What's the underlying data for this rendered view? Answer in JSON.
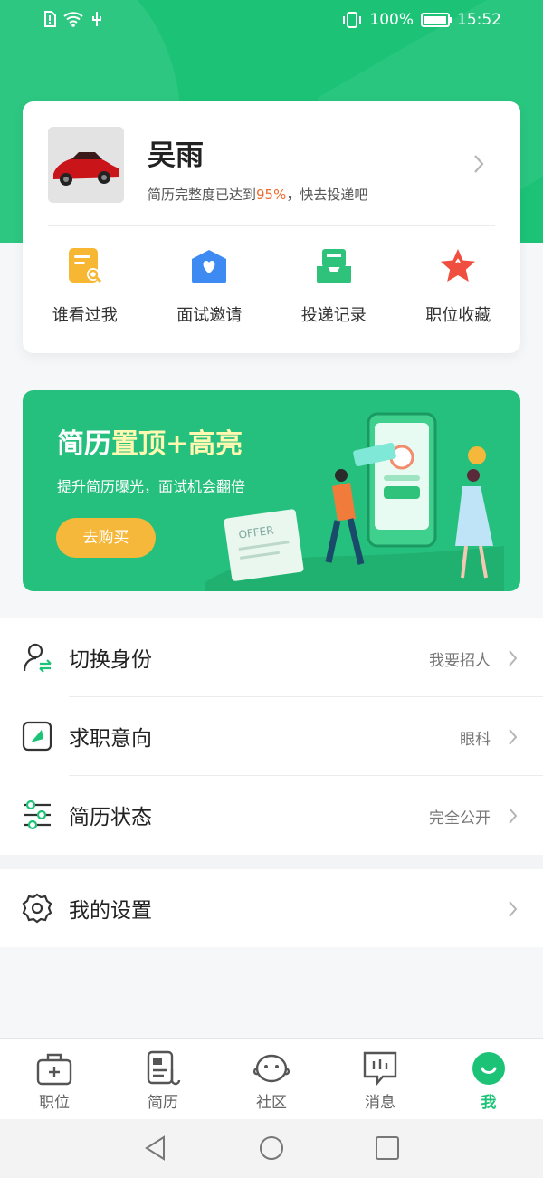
{
  "status_bar": {
    "battery": "100%",
    "time": "15:52"
  },
  "profile": {
    "name": "吴雨",
    "completeness_prefix": "简历完整度已达到",
    "completeness_pct": "95%",
    "completeness_suffix": "，快去投递吧"
  },
  "quick_actions": [
    {
      "label": "谁看过我",
      "icon": "viewed-me-icon",
      "color": "#f7b733"
    },
    {
      "label": "面试邀请",
      "icon": "interview-invite-icon",
      "color": "#3d8bf2"
    },
    {
      "label": "投递记录",
      "icon": "delivery-record-icon",
      "color": "#2fc27a"
    },
    {
      "label": "职位收藏",
      "icon": "favorite-star-icon",
      "color": "#f04e3e"
    }
  ],
  "promo": {
    "title_part1": "简历",
    "title_part2": "置顶+高亮",
    "subtitle": "提升简历曝光，面试机会翻倍",
    "button": "去购买",
    "art_text": "OFFER"
  },
  "menu": [
    {
      "title": "切换身份",
      "value": "我要招人",
      "icon": "switch-identity-icon"
    },
    {
      "title": "求职意向",
      "value": "眼科",
      "icon": "job-intent-icon"
    },
    {
      "title": "简历状态",
      "value": "完全公开",
      "icon": "resume-status-icon"
    }
  ],
  "settings": {
    "title": "我的设置",
    "icon": "settings-gear-icon"
  },
  "tabs": [
    {
      "label": "职位",
      "icon": "briefcase-icon"
    },
    {
      "label": "简历",
      "icon": "resume-icon"
    },
    {
      "label": "社区",
      "icon": "community-icon"
    },
    {
      "label": "消息",
      "icon": "message-icon"
    },
    {
      "label": "我",
      "icon": "me-icon"
    }
  ],
  "colors": {
    "brand": "#1cc377",
    "accent": "#ee6a2d",
    "promo_button": "#f6b83b"
  }
}
